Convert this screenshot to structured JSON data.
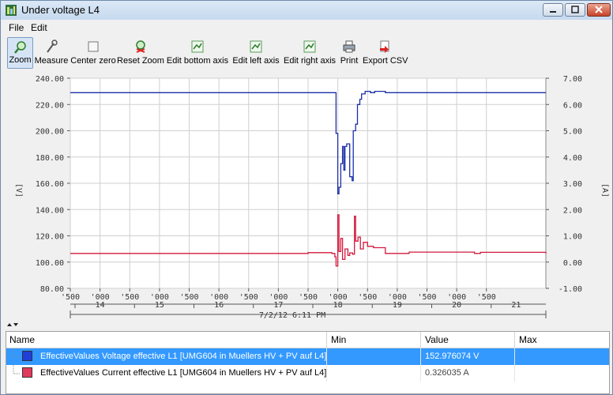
{
  "window": {
    "title": "Under voltage L4"
  },
  "menu": [
    "File",
    "Edit"
  ],
  "toolbar": [
    {
      "label": "Zoom",
      "icon": "zoom-icon",
      "active": true
    },
    {
      "label": "Measure",
      "icon": "measure-icon"
    },
    {
      "label": "Center zero",
      "icon": "center-zero-icon"
    },
    {
      "label": "Reset Zoom",
      "icon": "reset-zoom-icon"
    },
    {
      "label": "Edit bottom axis",
      "icon": "axis-icon"
    },
    {
      "label": "Edit left axis",
      "icon": "axis-icon"
    },
    {
      "label": "Edit right axis",
      "icon": "axis-icon"
    },
    {
      "label": "Print",
      "icon": "printer-icon"
    },
    {
      "label": "Export CSV",
      "icon": "csv-export-icon"
    }
  ],
  "chart_data": {
    "type": "line",
    "ylabel_left": "[V]",
    "ylabel_right": "[A]",
    "left_ticks": [
      "240.00",
      "220.00",
      "200.00",
      "180.00",
      "160.00",
      "140.00",
      "120.00",
      "100.00",
      "80.00"
    ],
    "right_ticks": [
      "7.00",
      "6.00",
      "5.00",
      "4.00",
      "3.00",
      "2.00",
      "1.00",
      "0.00",
      "-1.00"
    ],
    "ylim_left": [
      80,
      240
    ],
    "ylim_right": [
      -1,
      7
    ],
    "x_minor_ticks": [
      "'500",
      "'000",
      "'500",
      "'000",
      "'500",
      "'000",
      "'500",
      "'000",
      "'500",
      "'000",
      "'500",
      "'000",
      "'500",
      "'000",
      "'500"
    ],
    "x_major_ticks": [
      "14",
      "15",
      "16",
      "17",
      "18",
      "19",
      "20",
      "21"
    ],
    "x_date": "7/2/12  6:11  PM",
    "xlim": [
      13.5,
      21.5
    ],
    "grid": true,
    "series": [
      {
        "name": "EffectiveValues Voltage effective L1 [UMG604 in Muellers HV + PV auf L4]",
        "axis": "left",
        "color": "#1b2fa8",
        "x": [
          13.5,
          17.95,
          17.97,
          18.0,
          18.02,
          18.05,
          18.08,
          18.1,
          18.12,
          18.15,
          18.2,
          18.24,
          18.26,
          18.3,
          18.33,
          18.37,
          18.4,
          18.46,
          18.5,
          18.55,
          18.62,
          18.8,
          19.5,
          21.5
        ],
        "values": [
          229,
          229,
          198,
          152,
          157,
          175,
          188,
          170,
          188,
          190,
          165,
          162,
          200,
          205,
          220,
          224,
          228,
          230,
          230,
          229,
          230,
          229,
          229,
          229
        ]
      },
      {
        "name": "EffectiveValues Current effective L1 [UMG604 in Muellers HV + PV auf L4]",
        "axis": "right",
        "color": "#d11a3c",
        "x": [
          13.5,
          17.4,
          17.5,
          17.9,
          17.95,
          17.97,
          18.0,
          18.02,
          18.05,
          18.08,
          18.12,
          18.17,
          18.2,
          18.25,
          18.28,
          18.3,
          18.34,
          18.38,
          18.43,
          18.5,
          18.6,
          18.8,
          19.2,
          20.3,
          20.4,
          21.5
        ],
        "values": [
          0.33,
          0.33,
          0.36,
          0.33,
          0.2,
          -0.15,
          1.8,
          0.4,
          0.9,
          0.1,
          0.5,
          0.25,
          0.35,
          0.3,
          1.75,
          0.8,
          0.95,
          0.5,
          0.75,
          0.6,
          0.55,
          0.33,
          0.38,
          0.33,
          0.37,
          0.33
        ]
      }
    ]
  },
  "legend_table": {
    "columns": [
      "Name",
      "Min",
      "Value",
      "Max"
    ],
    "rows": [
      {
        "name": "EffectiveValues Voltage effective L1 [UMG604 in Muellers HV + PV auf L4]",
        "min": "",
        "value": "152.976074 V",
        "max": "",
        "color": "#1e3fd8",
        "selected": true
      },
      {
        "name": "EffectiveValues Current effective L1 [UMG604 in Muellers HV + PV auf L4]",
        "min": "",
        "value": "0.326035 A",
        "max": "",
        "color": "#e23a5c",
        "selected": false
      }
    ]
  }
}
